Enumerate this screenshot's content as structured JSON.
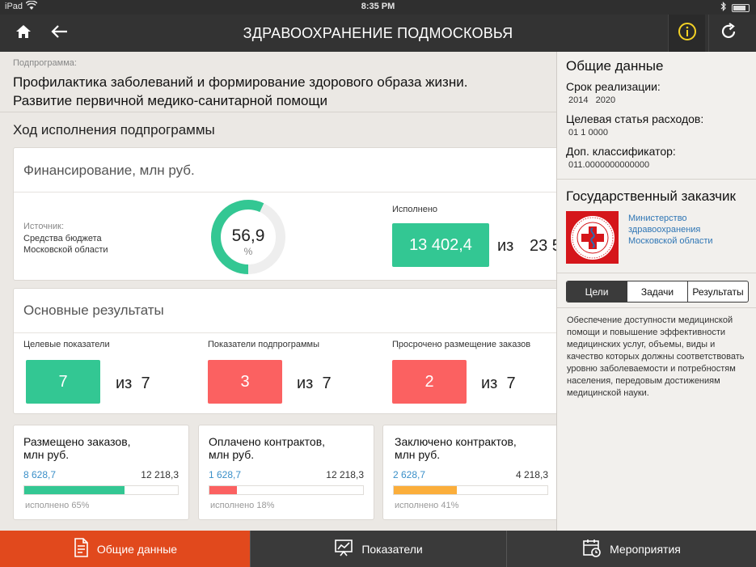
{
  "status_bar": {
    "device": "iPad",
    "time": "8:35 PM"
  },
  "header": {
    "title": "ЗДРАВООХРАНЕНИЕ ПОДМОСКОВЬЯ"
  },
  "subprogram": {
    "label": "Подпрограмма:",
    "title_line1": "Профилактика заболеваний и формирование здорового образа жизни.",
    "title_line2": "Развитие первичной медико-санитарной помощи"
  },
  "progress_title": "Ход исполнения подпрограммы",
  "financing": {
    "title": "Финансирование, млн руб.",
    "source_label": "Источник:",
    "source_value": "Средства бюджета Московской области",
    "gauge_value": "56,9",
    "gauge_percent": 56.9,
    "gauge_unit": "%",
    "executed_label": "Исполнено",
    "executed_value": "13 402,4",
    "of": "из",
    "total": "23 5"
  },
  "results": {
    "title": "Основные результаты",
    "items": [
      {
        "label": "Целевые показатели",
        "value": "7",
        "of": "из",
        "total": "7",
        "color": "#33c793"
      },
      {
        "label": "Показатели подпрограммы",
        "value": "3",
        "of": "из",
        "total": "7",
        "color": "#fb6161"
      },
      {
        "label": "Просрочено размещение заказов",
        "value": "2",
        "of": "из",
        "total": "7",
        "color": "#fb6161"
      }
    ]
  },
  "contracts": [
    {
      "title_line1": "Размещено заказов,",
      "title_line2": "млн руб.",
      "value": "8 628,7",
      "total": "12 218,3",
      "percent_text": "исполнено 65%",
      "fraction": 0.65,
      "color": "#33c793"
    },
    {
      "title_line1": "Оплачено контрактов,",
      "title_line2": "млн руб.",
      "value": "1 628,7",
      "total": "12 218,3",
      "percent_text": "исполнено 18%",
      "fraction": 0.18,
      "color": "#fb6161"
    },
    {
      "title_line1": "Заключено контрактов,",
      "title_line2": "млн руб.",
      "value": "2 628,7",
      "total": "4 218,3",
      "percent_text": "исполнено 41%",
      "fraction": 0.41,
      "color": "#fbae3b"
    }
  ],
  "panel": {
    "general_title": "Общие данные",
    "period_label": "Срок реализации:",
    "period_value": "2014   2020",
    "expense_label": "Целевая статья расходов:",
    "expense_value": "01 1 0000",
    "classifier_label": "Доп. классификатор:",
    "classifier_value": "011.0000000000000",
    "customer_title": "Государственный заказчик",
    "customer_line1": "Министерство",
    "customer_line2": "здравоохранения",
    "customer_line3": "Московской области",
    "logo_text": "МИНИСТЕРСТВО ЗДРАВООХРАНЕНИЯ МОСКОВСКОЙ ОБЛАСТИ",
    "segments": [
      "Цели",
      "Задачи",
      "Результаты"
    ],
    "active_segment": 0,
    "goal_text": "Обеспечение доступности медицинской помощи и повышение эффективности медицинских услуг, объемы, виды и качество которых должны соответствовать уровню заболеваемости и потребностям населения, передовым достижениям медицинской науки."
  },
  "tabs": [
    {
      "label": "Общие данные",
      "icon": "document-icon",
      "active": true
    },
    {
      "label": "Показатели",
      "icon": "chart-board-icon",
      "active": false
    },
    {
      "label": "Мероприятия",
      "icon": "calendar-icon",
      "active": false
    }
  ],
  "colors": {
    "green": "#33c793",
    "red": "#fb6161",
    "orange": "#fbae3b",
    "accent": "#e1491d",
    "info": "#f4d225"
  }
}
